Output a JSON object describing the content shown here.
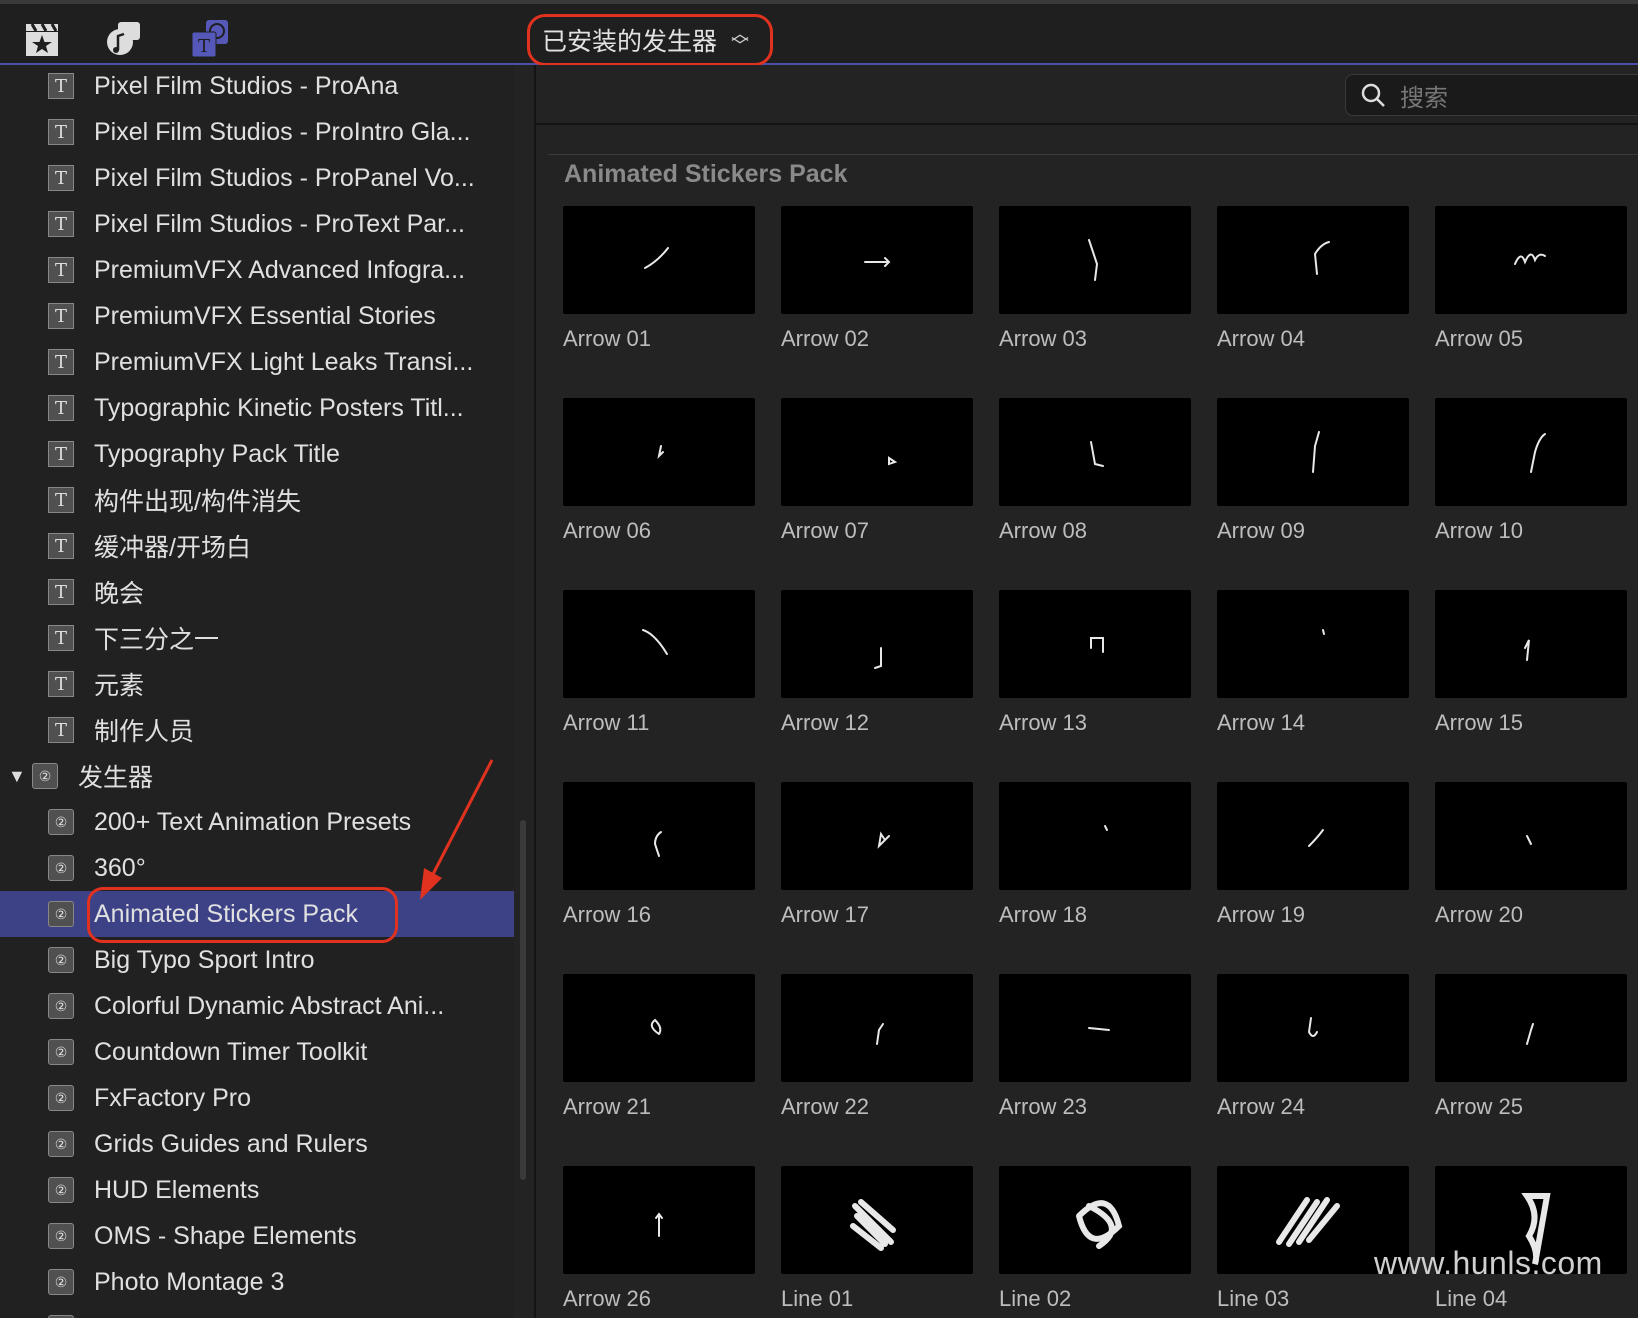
{
  "toolbar": {
    "icons": [
      "clapper-star-icon",
      "music-photo-icon",
      "titles-generators-icon"
    ],
    "dropdown_label": "已安装的发生器"
  },
  "sidebar": {
    "title_items": [
      "Pixel Film Studios - ProAna",
      "Pixel Film Studios - ProIntro Gla...",
      "Pixel Film Studios - ProPanel Vo...",
      "Pixel Film Studios - ProText Par...",
      "PremiumVFX Advanced Infogra...",
      "PremiumVFX Essential Stories",
      "PremiumVFX Light Leaks Transi...",
      "Typographic Kinetic Posters Titl...",
      "Typography Pack Title",
      "构件出现/构件消失",
      "缓冲器/开场白",
      "晚会",
      "下三分之一",
      "元素",
      "制作人员"
    ],
    "group_label": "发生器",
    "generator_items": [
      "200+ Text Animation Presets",
      "360°",
      "Animated Stickers Pack",
      "Big Typo Sport Intro",
      "Colorful Dynamic Abstract Ani...",
      "Countdown Timer Toolkit",
      "FxFactory Pro",
      "Grids Guides and Rulers",
      "HUD Elements",
      "OMS - Shape Elements",
      "Photo Montage 3"
    ],
    "selected": "Animated Stickers Pack"
  },
  "search": {
    "placeholder": "搜索"
  },
  "browser": {
    "section_title": "Animated Stickers Pack",
    "items": [
      "Arrow 01",
      "Arrow 02",
      "Arrow 03",
      "Arrow 04",
      "Arrow 05",
      "Arrow 06",
      "Arrow 07",
      "Arrow 08",
      "Arrow 09",
      "Arrow 10",
      "Arrow 11",
      "Arrow 12",
      "Arrow 13",
      "Arrow 14",
      "Arrow 15",
      "Arrow 16",
      "Arrow 17",
      "Arrow 18",
      "Arrow 19",
      "Arrow 20",
      "Arrow 21",
      "Arrow 22",
      "Arrow 23",
      "Arrow 24",
      "Arrow 25",
      "Arrow 26",
      "Line 01",
      "Line 02",
      "Line 03",
      "Line 04"
    ]
  },
  "watermark": "www.hunls.com",
  "colors": {
    "accent": "#3d4287",
    "highlight": "#e0321f"
  }
}
